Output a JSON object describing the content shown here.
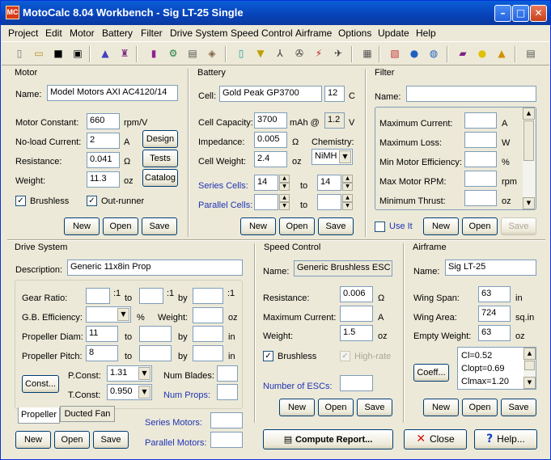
{
  "title": "MotoCalc 8.04 Workbench - Sig LT-25 Single",
  "app_icon": "MC",
  "menu": [
    "Project",
    "Edit",
    "Motor",
    "Battery",
    "Filter",
    "Drive System",
    "Speed Control",
    "Airframe",
    "Options",
    "Update",
    "Help"
  ],
  "toolbar_icons": [
    "new-doc-icon",
    "open-doc-icon",
    "save-icon",
    "save-as-icon",
    "prop-icon",
    "motor-bench-icon",
    "battery-pack-icon",
    "drive-icon",
    "cell-icon",
    "data-icon",
    "battery-icon",
    "filter-icon",
    "propeller-icon",
    "fan-icon",
    "esc-icon",
    "airplane-icon",
    "report-icon",
    "graph-icon",
    "globe-icon",
    "globe2-icon",
    "book-icon",
    "tip-icon",
    "warning-icon",
    "exit-icon"
  ],
  "motor": {
    "group": "Motor",
    "name_label": "Name:",
    "name": "Model Motors AXI AC4120/14",
    "kv_label": "Motor Constant:",
    "kv": "660",
    "kv_unit": "rpm/V",
    "noload_label": "No-load Current:",
    "noload": "2",
    "noload_unit": "A",
    "res_label": "Resistance:",
    "res": "0.041",
    "res_unit": "Ω",
    "weight_label": "Weight:",
    "weight": "11.3",
    "weight_unit": "oz",
    "design": "Design",
    "tests": "Tests",
    "catalog": "Catalog",
    "brushless": "Brushless",
    "outrunner": "Out-runner",
    "new": "New",
    "open": "Open",
    "save": "Save"
  },
  "battery": {
    "group": "Battery",
    "cell_label": "Cell:",
    "cell": "Gold Peak GP3700",
    "cell_c": "12",
    "c_unit": "C",
    "cap_label": "Cell Capacity:",
    "cap": "3700",
    "cap_unit": "mAh @",
    "cap_v": "1.2",
    "v_unit": "V",
    "imp_label": "Impedance:",
    "imp": "0.005",
    "imp_unit": "Ω",
    "chem_label": "Chemistry:",
    "chem": "NiMH",
    "cw_label": "Cell Weight:",
    "cw": "2.4",
    "cw_unit": "oz",
    "series_label": "Series Cells:",
    "series_from": "14",
    "series_to": "14",
    "to": "to",
    "parallel_label": "Parallel Cells:",
    "new": "New",
    "open": "Open",
    "save": "Save"
  },
  "filter": {
    "group": "Filter",
    "name_label": "Name:",
    "items": [
      {
        "label": "Maximum Current:",
        "unit": "A"
      },
      {
        "label": "Maximum Loss:",
        "unit": "W"
      },
      {
        "label": "Min Motor Efficiency:",
        "unit": "%"
      },
      {
        "label": "Max Motor RPM:",
        "unit": "rpm"
      },
      {
        "label": "Minimum Thrust:",
        "unit": "oz"
      }
    ],
    "useit": "Use It",
    "new": "New",
    "open": "Open",
    "save": "Save"
  },
  "drive": {
    "group": "Drive System",
    "desc_label": "Description:",
    "desc": "Generic 11x8in Prop",
    "gear_label": "Gear Ratio:",
    "colon1": ":1",
    "to": "to",
    "by": "by",
    "gbeff_label": "G.B. Efficiency:",
    "pct": "%",
    "weight_label": "Weight:",
    "oz": "oz",
    "pdiam_label": "Propeller Diam:",
    "pdiam": "11",
    "in": "in",
    "ppitch_label": "Propeller Pitch:",
    "ppitch": "8",
    "const_btn": "Const...",
    "pconst_label": "P.Const:",
    "pconst": "1.31",
    "tconst_label": "T.Const:",
    "tconst": "0.950",
    "blades_label": "Num Blades:",
    "props_label": "Num Props:",
    "tab_prop": "Propeller",
    "tab_fan": "Ducted Fan",
    "series_motors": "Series Motors:",
    "parallel_motors": "Parallel Motors:",
    "new": "New",
    "open": "Open",
    "save": "Save"
  },
  "esc": {
    "group": "Speed Control",
    "name_label": "Name:",
    "name": "Generic Brushless ESC",
    "res_label": "Resistance:",
    "res": "0.006",
    "res_unit": "Ω",
    "maxcur_label": "Maximum Current:",
    "maxcur_unit": "A",
    "weight_label": "Weight:",
    "weight": "1.5",
    "weight_unit": "oz",
    "brushless": "Brushless",
    "highrate": "High-rate",
    "numesc_label": "Number of ESCs:",
    "new": "New",
    "open": "Open",
    "save": "Save"
  },
  "airframe": {
    "group": "Airframe",
    "name_label": "Name:",
    "name": "Sig LT-25",
    "span_label": "Wing Span:",
    "span": "63",
    "span_unit": "in",
    "area_label": "Wing Area:",
    "area": "724",
    "area_unit": "sq.in",
    "ew_label": "Empty Weight:",
    "ew": "63",
    "ew_unit": "oz",
    "coeff_btn": "Coeff...",
    "coeffs": [
      "Cl=0.52",
      "Clopt=0.69",
      "Clmax=1.20"
    ],
    "new": "New",
    "open": "Open",
    "save": "Save"
  },
  "bottom": {
    "compute": "Compute Report...",
    "close": "Close",
    "help": "Help..."
  }
}
